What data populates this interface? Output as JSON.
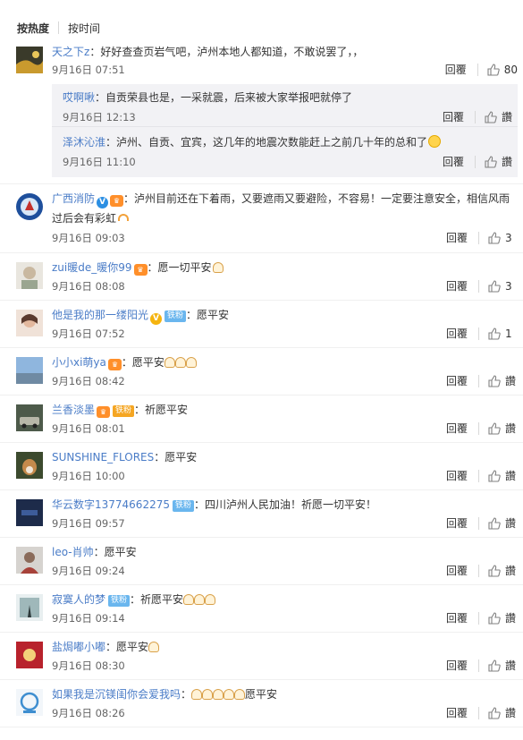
{
  "sort": {
    "hot": "按热度",
    "time": "按时间"
  },
  "colors": {
    "username": "#eb7350",
    "accent_blue": "#4a7cc7",
    "reply_bg": "#f2f2f5"
  },
  "comments": [
    {
      "user": "天之下z",
      "text": "：好好查查页岩气吧，泸州本地人都知道，不敢说罢了，，",
      "time": "9月16日 07:51",
      "reply": "回覆",
      "likes": "80",
      "replies": [
        {
          "user": "哎啊啾",
          "text": "：自贡荣县也是，一采就震，后来被大家举报吧就停了",
          "time": "9月16日 12:13",
          "reply": "回覆",
          "likes": "讚"
        },
        {
          "user": "泽沐沁淮",
          "text": "：泸州、自贡、宜宾，这几年的地震次数能赶上之前几十年的总和了",
          "time": "9月16日 11:10",
          "reply": "回覆",
          "likes": "讚"
        }
      ]
    },
    {
      "user": "广西消防",
      "text": "：泸州目前还在下着雨，又要遮雨又要避险，不容易！一定要注意安全，相信风雨",
      "text2": "过后会有彩虹",
      "time": "9月16日 09:03",
      "reply": "回覆",
      "likes": "3"
    },
    {
      "user": "zui暖de_暖你99",
      "text": "：愿一切平安",
      "time": "9月16日 08:08",
      "reply": "回覆",
      "likes": "3"
    },
    {
      "user": "他是我的那一缕阳光",
      "badge": "铁粉",
      "text": "：愿平安",
      "time": "9月16日 07:52",
      "reply": "回覆",
      "likes": "1"
    },
    {
      "user": "小小xi萌ya",
      "text": "：愿平安",
      "time": "9月16日 08:42",
      "reply": "回覆",
      "likes": "讚"
    },
    {
      "user": "兰香淡墨",
      "badge": "铁粉",
      "text": "：祈愿平安",
      "time": "9月16日 08:01",
      "reply": "回覆",
      "likes": "讚"
    },
    {
      "user": "SUNSHINE_FLORES",
      "text": "：愿平安",
      "time": "9月16日 10:00",
      "reply": "回覆",
      "likes": "讚"
    },
    {
      "user": "华云数字13774662275",
      "badge": "铁粉",
      "text": "：四川泸州人民加油！祈愿一切平安！",
      "time": "9月16日 09:57",
      "reply": "回覆",
      "likes": "讚"
    },
    {
      "user": "leo-肖帅",
      "text": "：愿平安",
      "time": "9月16日 09:24",
      "reply": "回覆",
      "likes": "讚"
    },
    {
      "user": "寂寞人的梦",
      "badge": "铁粉",
      "text": "：祈愿平安",
      "time": "9月16日 09:14",
      "reply": "回覆",
      "likes": "讚"
    },
    {
      "user": "盐焗嘟小嘟",
      "text": "：愿平安",
      "time": "9月16日 08:30",
      "reply": "回覆",
      "likes": "讚"
    },
    {
      "user": "如果我是沉镁闺你会爱我吗",
      "text": "：",
      "text2": "愿平安",
      "time": "9月16日 08:26",
      "reply": "回覆",
      "likes": "讚"
    }
  ]
}
